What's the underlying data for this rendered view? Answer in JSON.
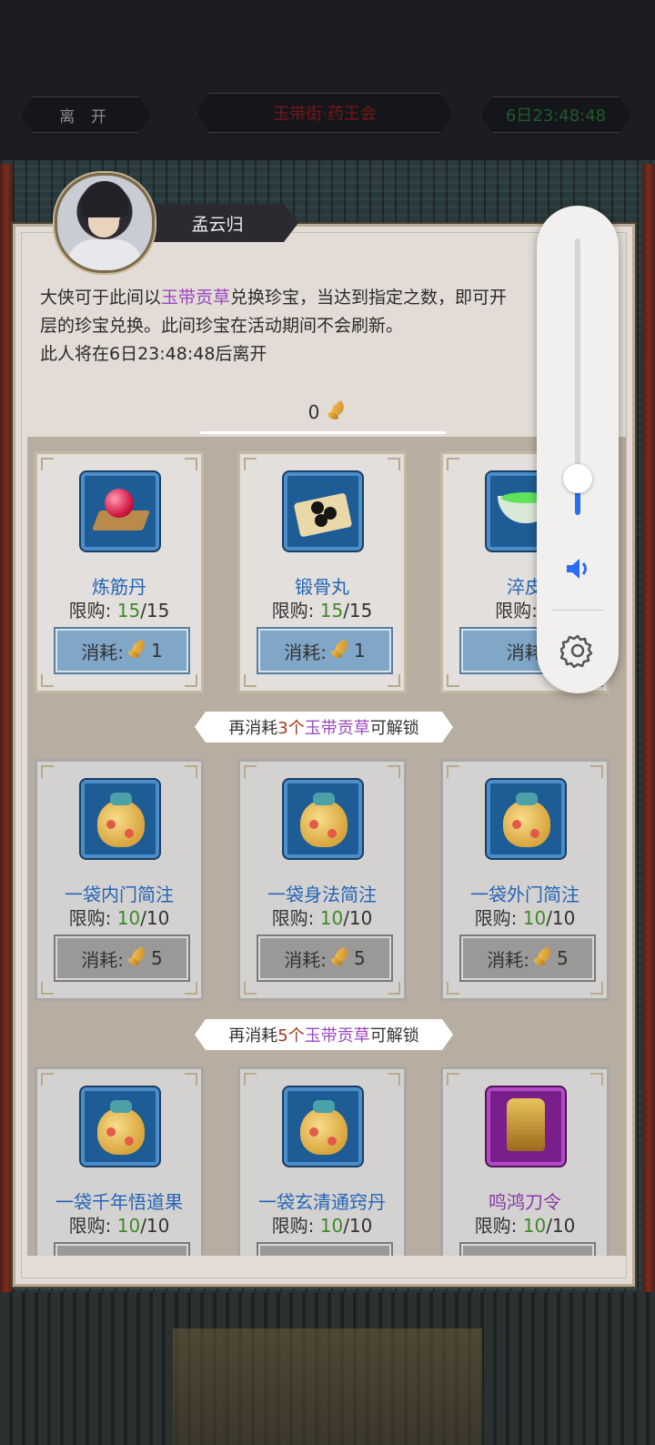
{
  "topbar": {
    "leave_label": "离 开",
    "title": "玉带街·药王会",
    "timer": "6日23:48:48"
  },
  "npc": {
    "name": "孟云归"
  },
  "description": {
    "line1_pre": "大侠可于此间以",
    "line1_hl": "玉带贡草",
    "line1_post": "兑换珍宝，当达到指定之数，即可开",
    "line2": "层的珍宝兑换。此间珍宝在活动期间不会刷新。",
    "line3": "此人将在6日23:48:48后离开"
  },
  "currency": {
    "amount": "0",
    "icon": "golden-leaf-icon"
  },
  "tiers": [
    {
      "unlock": null,
      "items": [
        {
          "name": "炼筋丹",
          "limit_label": "限购:",
          "limit_cur": "15",
          "limit_max": "/15",
          "cost_label": "消耗:",
          "cost": "1",
          "icon": "red-pill-icon"
        },
        {
          "name": "锻骨丸",
          "limit_label": "限购:",
          "limit_cur": "15",
          "limit_max": "/15",
          "cost_label": "消耗:",
          "cost": "1",
          "icon": "black-pills-icon"
        },
        {
          "name": "淬皮",
          "limit_label": "限购:",
          "limit_cur": "1",
          "limit_max": "",
          "cost_label": "消耗:",
          "cost": "",
          "icon": "green-bowl-icon"
        }
      ]
    },
    {
      "unlock": {
        "pre": "再消耗",
        "num": "3个",
        "hl": "玉带贡草",
        "post": "可解锁"
      },
      "items": [
        {
          "name": "一袋内门简注",
          "limit_label": "限购:",
          "limit_cur": "10",
          "limit_max": "/10",
          "cost_label": "消耗:",
          "cost": "5",
          "icon": "gold-bag-icon"
        },
        {
          "name": "一袋身法简注",
          "limit_label": "限购:",
          "limit_cur": "10",
          "limit_max": "/10",
          "cost_label": "消耗:",
          "cost": "5",
          "icon": "gold-bag-icon"
        },
        {
          "name": "一袋外门简注",
          "limit_label": "限购:",
          "limit_cur": "10",
          "limit_max": "/10",
          "cost_label": "消耗:",
          "cost": "5",
          "icon": "gold-bag-icon"
        }
      ]
    },
    {
      "unlock": {
        "pre": "再消耗",
        "num": "5个",
        "hl": "玉带贡草",
        "post": "可解锁"
      },
      "items": [
        {
          "name": "一袋千年悟道果",
          "limit_label": "限购:",
          "limit_cur": "10",
          "limit_max": "/10",
          "icon": "gold-bag-icon"
        },
        {
          "name": "一袋玄清通窍丹",
          "limit_label": "限购:",
          "limit_cur": "10",
          "limit_max": "/10",
          "icon": "gold-bag-icon"
        },
        {
          "name": "鸣鸿刀令",
          "limit_label": "限购:",
          "limit_cur": "10",
          "limit_max": "/10",
          "icon": "golden-token-icon"
        }
      ]
    }
  ],
  "volume_overlay": {
    "level": 0.25,
    "speaker_icon": "speaker-icon",
    "settings_icon": "gear-icon"
  }
}
